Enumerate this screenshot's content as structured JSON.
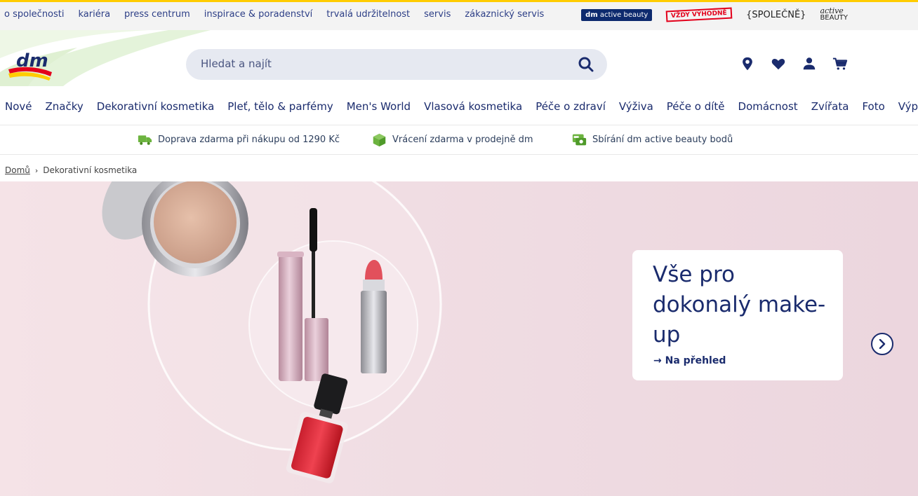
{
  "top_bar": {
    "links": [
      "o společnosti",
      "kariéra",
      "press centrum",
      "inspirace & poradenství",
      "trvalá udržitelnost",
      "servis",
      "zákaznický servis"
    ],
    "brands": {
      "active_beauty": "active beauty",
      "vzdy_vyhodne": "VŽDY VÝHODNĚ",
      "spolecne": "{SPOLEČNĚ}",
      "active_beauty_logo_top": "active",
      "active_beauty_logo_bottom": "BEAUTY"
    }
  },
  "header": {
    "logo_text": "dm",
    "search": {
      "placeholder": "Hledat a najít"
    },
    "icons": [
      "location-icon",
      "heart-icon",
      "user-icon",
      "cart-icon"
    ]
  },
  "nav": {
    "items": [
      "Nové",
      "Značky",
      "Dekorativní kosmetika",
      "Pleť, tělo & parfémy",
      "Men's World",
      "Vlasová kosmetika",
      "Péče o zdraví",
      "Výživa",
      "Péče o dítě",
      "Domácnost",
      "Zvířata",
      "Foto",
      "Výprodej"
    ]
  },
  "usp": {
    "shipping": "Doprava zdarma při nákupu od 1290 Kč",
    "returns": "Vrácení zdarma v prodejně dm",
    "points": "Sbírání dm active beauty bodů"
  },
  "breadcrumb": {
    "home": "Domů",
    "current": "Dekorativní kosmetika"
  },
  "hero": {
    "title": "Vše pro dokonalý make-up",
    "link": "→ Na přehled"
  },
  "colors": {
    "brand_navy": "#1a2b6d",
    "brand_yellow": "#ffcc00",
    "brand_red": "#e3001b",
    "usp_green": "#6cb33f"
  }
}
